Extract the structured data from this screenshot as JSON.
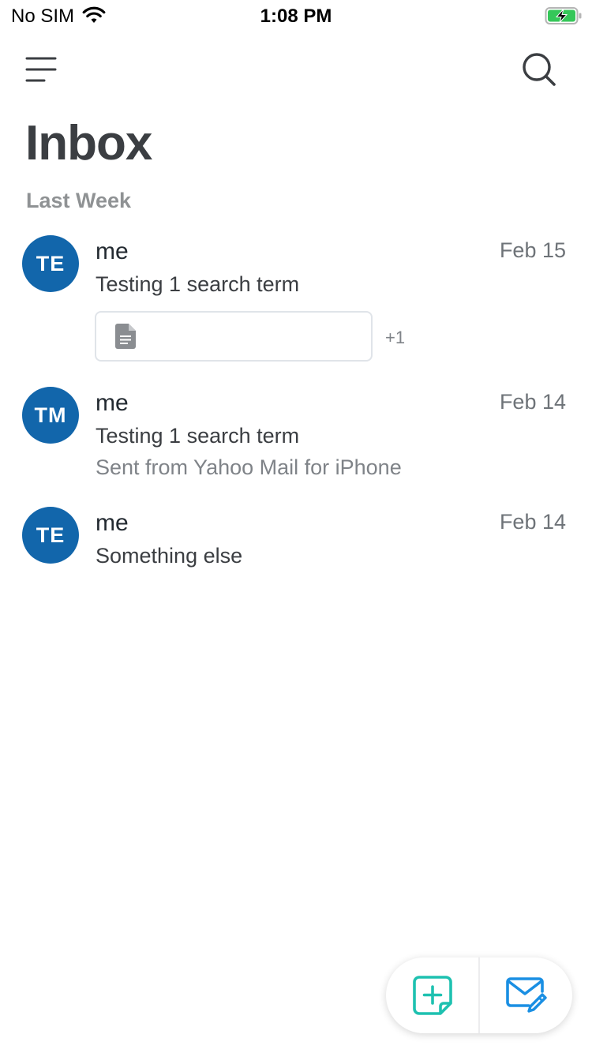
{
  "status_bar": {
    "carrier": "No SIM",
    "time": "1:08 PM"
  },
  "header": {
    "menu_icon": "hamburger-menu-icon",
    "search_icon": "search-icon",
    "title": "Inbox"
  },
  "section": {
    "label": "Last Week"
  },
  "messages": [
    {
      "initials": "TE",
      "sender": "me",
      "date": "Feb 15",
      "subject": "Testing 1 search term",
      "snippet": "",
      "attachment_icon": "document-icon",
      "attachment_more": "+1"
    },
    {
      "initials": "TM",
      "sender": "me",
      "date": "Feb 14",
      "subject": "Testing 1 search term",
      "snippet": "Sent from Yahoo Mail for iPhone"
    },
    {
      "initials": "TE",
      "sender": "me",
      "date": "Feb 14",
      "subject": "Something else"
    }
  ],
  "actions": {
    "left_icon": "add-note-icon",
    "right_icon": "compose-mail-icon"
  },
  "colors": {
    "avatar": "#1266ab",
    "accent_teal": "#1ec1b0",
    "accent_blue": "#1a8fe3",
    "battery_green": "#35c759"
  }
}
